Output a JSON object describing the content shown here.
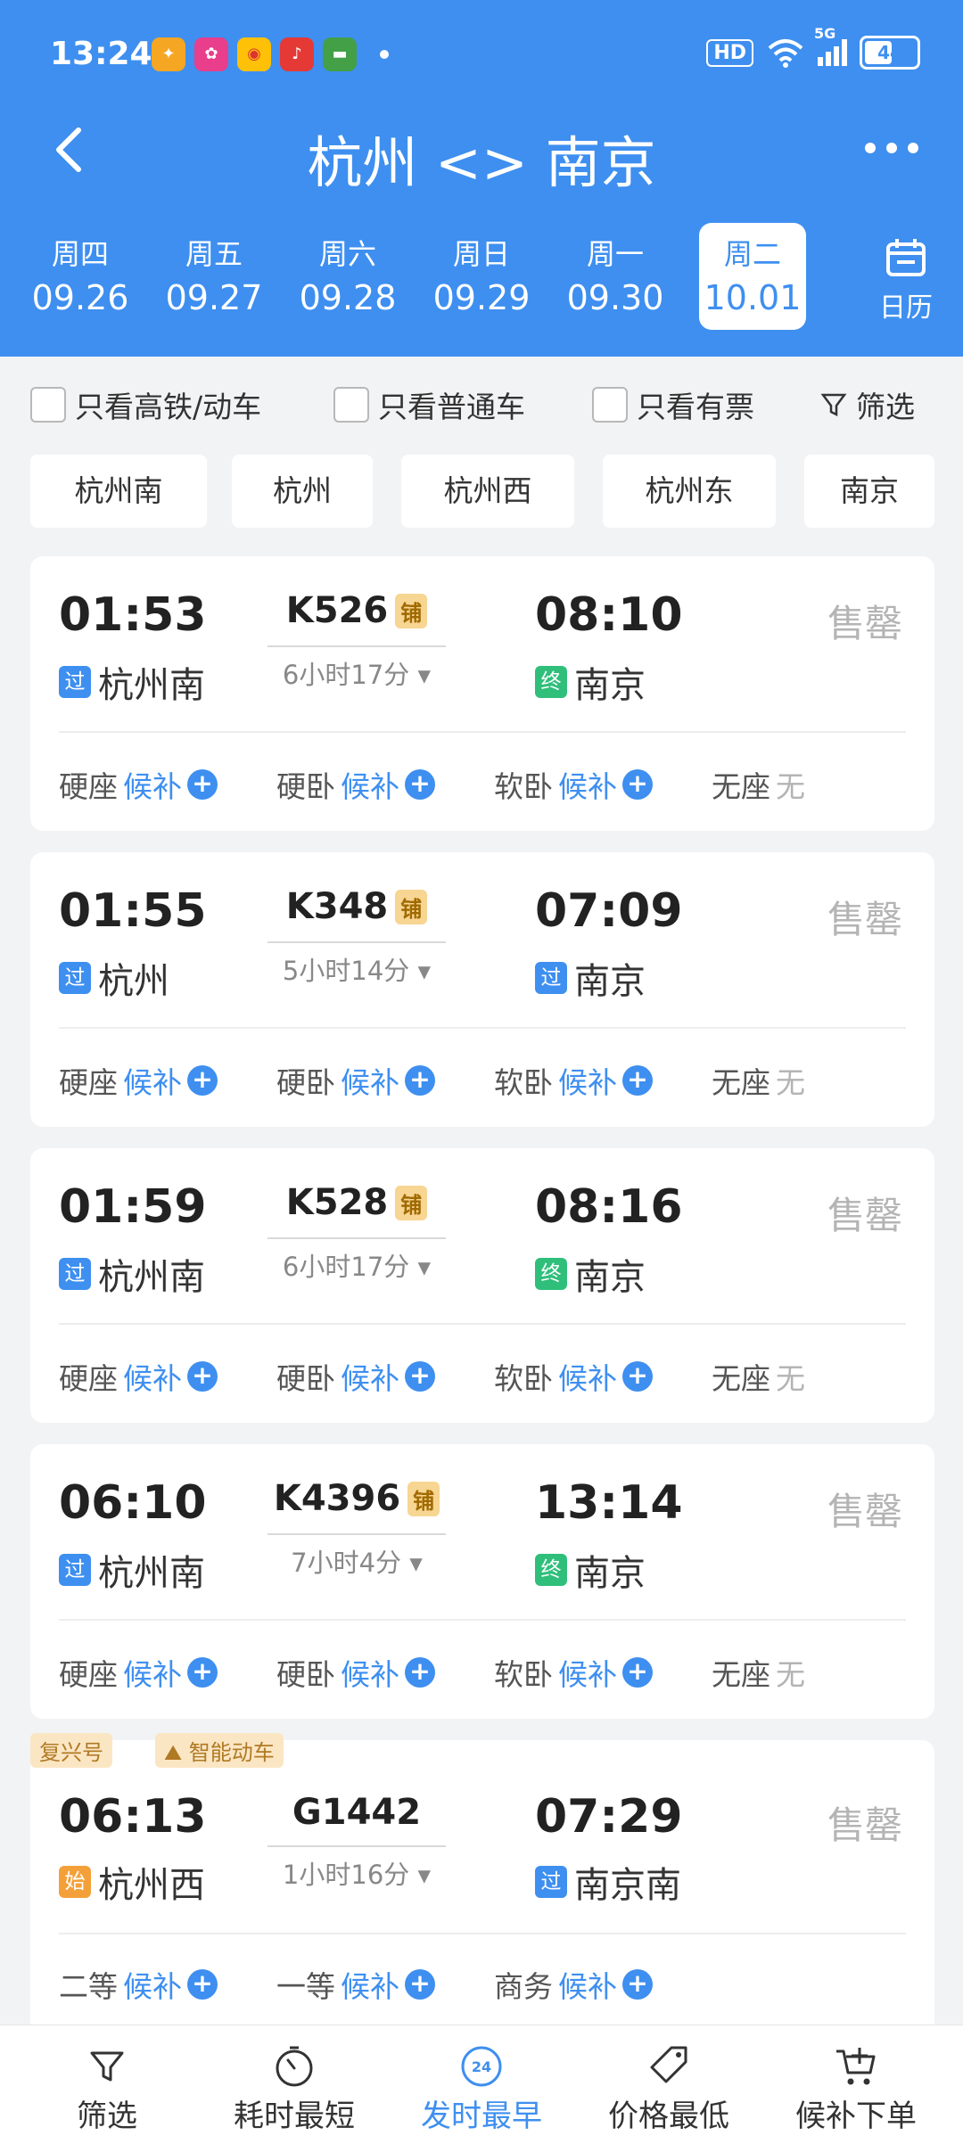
{
  "status": {
    "time": "13:24",
    "network": "5G",
    "battery": "44",
    "hd": "HD"
  },
  "header": {
    "title": "杭州 <> 南京"
  },
  "dates": [
    {
      "weekday": "周四",
      "date": "09.26"
    },
    {
      "weekday": "周五",
      "date": "09.27"
    },
    {
      "weekday": "周六",
      "date": "09.28"
    },
    {
      "weekday": "周日",
      "date": "09.29"
    },
    {
      "weekday": "周一",
      "date": "09.30"
    },
    {
      "weekday": "周二",
      "date": "10.01",
      "active": true
    }
  ],
  "calendar_label": "日历",
  "filters": {
    "hs": "只看高铁/动车",
    "normal": "只看普通车",
    "available": "只看有票",
    "screen": "筛选"
  },
  "stations": [
    "杭州南",
    "杭州",
    "杭州西",
    "杭州东",
    "南京"
  ],
  "trains": [
    {
      "dep": "01:53",
      "arr": "08:10",
      "no": "K526",
      "tag": "铺",
      "dur": "6小时17分",
      "from": "杭州南",
      "from_tag": "过",
      "to": "南京",
      "to_tag": "终",
      "status": "售罄",
      "seats": [
        {
          "type": "硬座",
          "val": "候补"
        },
        {
          "type": "硬卧",
          "val": "候补"
        },
        {
          "type": "软卧",
          "val": "候补"
        },
        {
          "type": "无座",
          "val": "无"
        }
      ]
    },
    {
      "dep": "01:55",
      "arr": "07:09",
      "no": "K348",
      "tag": "铺",
      "dur": "5小时14分",
      "from": "杭州",
      "from_tag": "过",
      "to": "南京",
      "to_tag": "过",
      "status": "售罄",
      "seats": [
        {
          "type": "硬座",
          "val": "候补"
        },
        {
          "type": "硬卧",
          "val": "候补"
        },
        {
          "type": "软卧",
          "val": "候补"
        },
        {
          "type": "无座",
          "val": "无"
        }
      ]
    },
    {
      "dep": "01:59",
      "arr": "08:16",
      "no": "K528",
      "tag": "铺",
      "dur": "6小时17分",
      "from": "杭州南",
      "from_tag": "过",
      "to": "南京",
      "to_tag": "终",
      "status": "售罄",
      "seats": [
        {
          "type": "硬座",
          "val": "候补"
        },
        {
          "type": "硬卧",
          "val": "候补"
        },
        {
          "type": "软卧",
          "val": "候补"
        },
        {
          "type": "无座",
          "val": "无"
        }
      ]
    },
    {
      "dep": "06:10",
      "arr": "13:14",
      "no": "K4396",
      "tag": "铺",
      "dur": "7小时4分",
      "from": "杭州南",
      "from_tag": "过",
      "to": "南京",
      "to_tag": "终",
      "status": "售罄",
      "seats": [
        {
          "type": "硬座",
          "val": "候补"
        },
        {
          "type": "硬卧",
          "val": "候补"
        },
        {
          "type": "软卧",
          "val": "候补"
        },
        {
          "type": "无座",
          "val": "无"
        }
      ]
    },
    {
      "badges": [
        "复兴号",
        "智能动车"
      ],
      "dep": "06:13",
      "arr": "07:29",
      "no": "G1442",
      "tag": "",
      "dur": "1小时16分",
      "from": "杭州西",
      "from_tag": "始",
      "to": "南京南",
      "to_tag": "过",
      "status": "售罄",
      "seats": [
        {
          "type": "二等",
          "val": "候补"
        },
        {
          "type": "一等",
          "val": "候补"
        },
        {
          "type": "商务",
          "val": "候补"
        }
      ]
    }
  ],
  "tabbar": [
    {
      "label": "筛选",
      "icon": "filter-icon"
    },
    {
      "label": "耗时最短",
      "icon": "timer-icon"
    },
    {
      "label": "发时最早",
      "icon": "clock-24-icon",
      "active": true,
      "icon_text": "24"
    },
    {
      "label": "价格最低",
      "icon": "price-tag-icon"
    },
    {
      "label": "候补下单",
      "icon": "cart-add-icon"
    }
  ],
  "colors": {
    "primary": "#3e8ff0",
    "green": "#2fbf7b",
    "orange": "#f4a03a"
  }
}
